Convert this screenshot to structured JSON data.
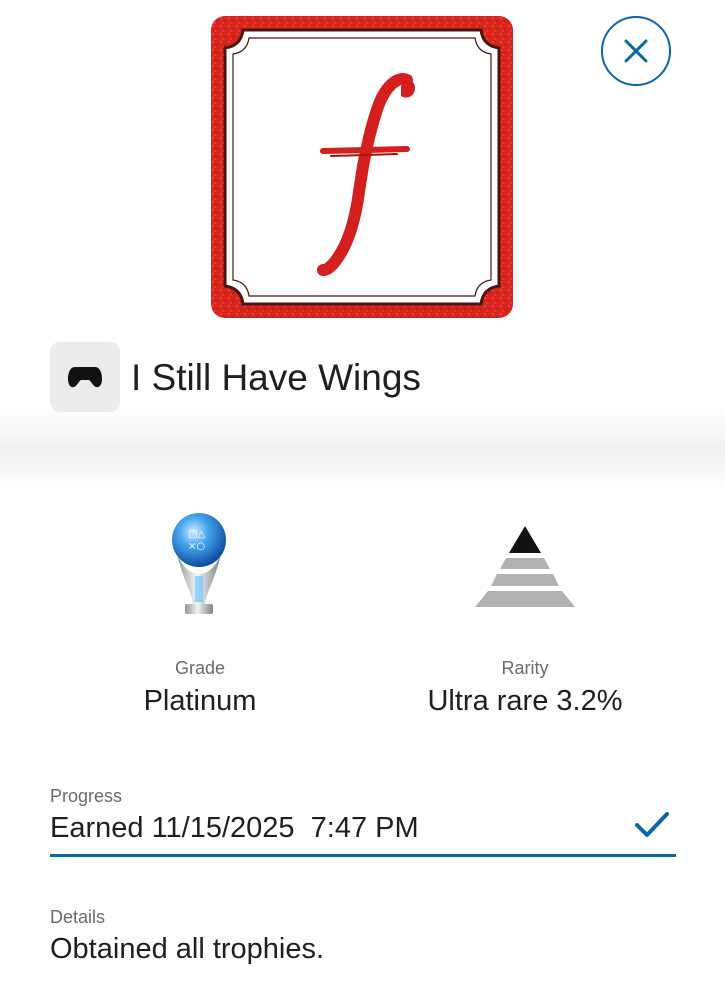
{
  "close_button": {
    "icon": "close-icon",
    "color": "#0b68a8"
  },
  "game_art": {
    "letter": "f",
    "accent": "#d41f1f"
  },
  "header": {
    "platform_icon": "gamepad-icon",
    "title": "I Still Have Wings"
  },
  "grade": {
    "icon": "platinum-trophy-icon",
    "label": "Grade",
    "value": "Platinum"
  },
  "rarity": {
    "icon": "rarity-pyramid-icon",
    "label": "Rarity",
    "value": "Ultra rare 3.2%"
  },
  "progress": {
    "label": "Progress",
    "value": "Earned 11/15/2025  7:47 PM",
    "status_icon": "checkmark-icon",
    "accent": "#0b68a8"
  },
  "details": {
    "label": "Details",
    "value": "Obtained all trophies."
  }
}
